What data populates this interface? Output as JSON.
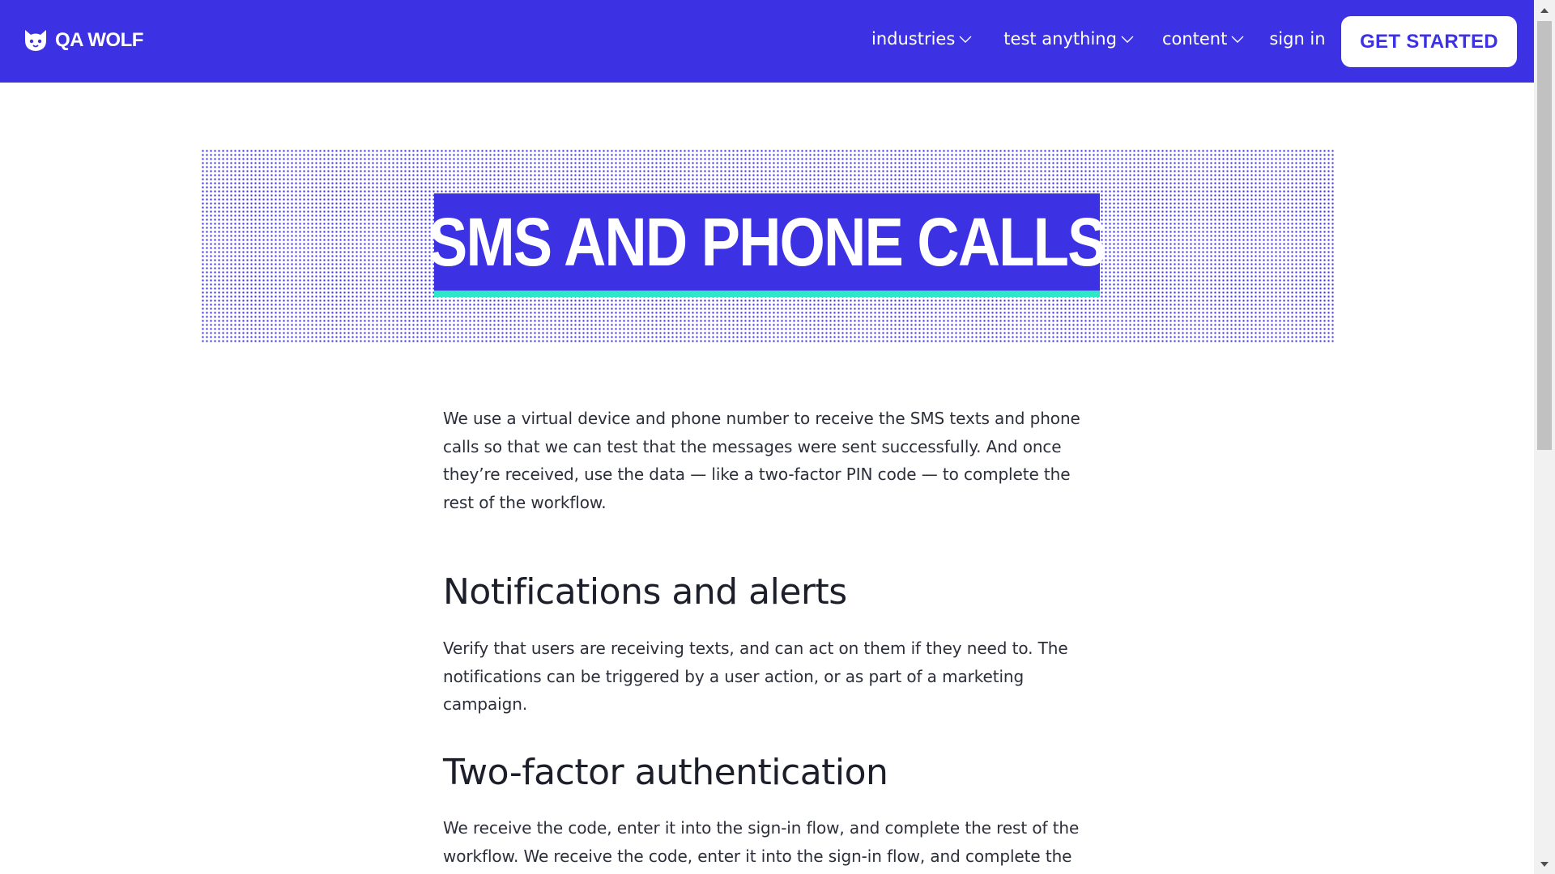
{
  "header": {
    "logo_text": "QA WOLF",
    "nav": [
      {
        "label": "industries"
      },
      {
        "label": "test anything"
      },
      {
        "label": "content"
      },
      {
        "label": "sign in"
      }
    ],
    "cta_label": "GET STARTED"
  },
  "hero": {
    "title": "SMS AND PHONE CALLS"
  },
  "content": {
    "intro": "We use a virtual device and phone number to receive the SMS texts and phone calls so that we can test that the messages were sent successfully. And once they’re received, use the data — like a two-factor PIN code — to complete the rest of the workflow.",
    "sections": [
      {
        "heading": "Notifications and alerts",
        "body": "Verify that users are receiving texts, and can act on them if they need to. The notifications can be triggered by a user action, or as part of a marketing campaign."
      },
      {
        "heading": "Two-factor authentication",
        "body": "We receive the code, enter it into the sign-in flow, and complete the rest of the workflow. We receive the code, enter it into the sign-in flow, and complete the"
      }
    ]
  },
  "colors": {
    "brand": "#3c32e4",
    "accent": "#2ee6c8",
    "text": "#2c2f3a"
  },
  "icons": {
    "logo": "wolf-head-icon",
    "dropdown": "chevron-down-icon"
  }
}
